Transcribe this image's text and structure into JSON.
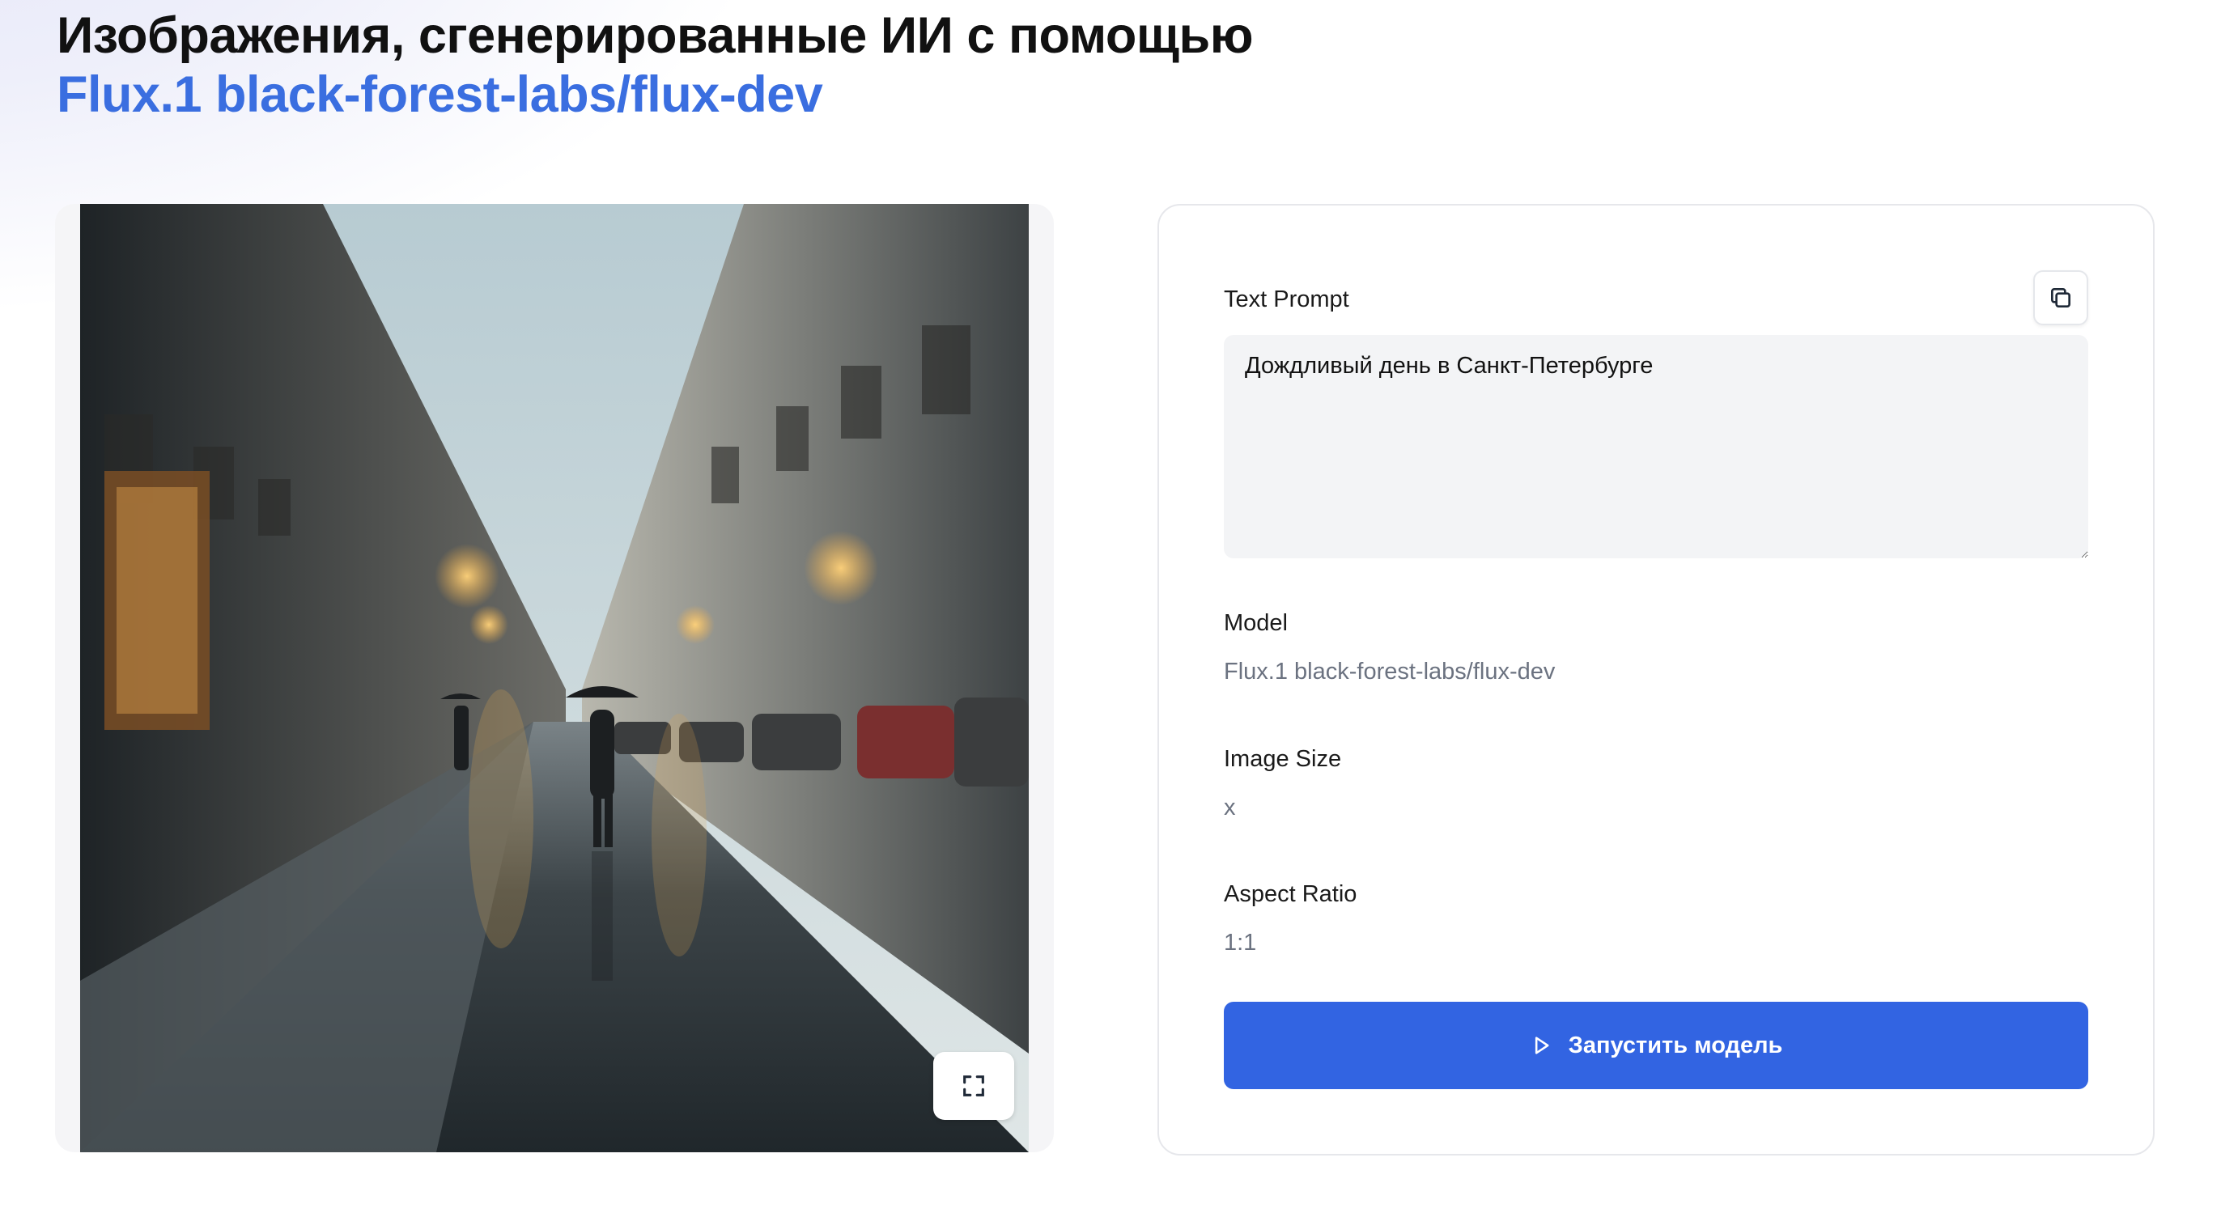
{
  "page": {
    "title_main": "Изображения, сгенерированные ИИ с помощью ",
    "title_model": "Flux.1 black-forest-labs/flux-dev"
  },
  "image_panel": {
    "image_icon": "generated-image",
    "fullscreen_icon": "fullscreen-icon"
  },
  "settings": {
    "prompt_label": "Text Prompt",
    "prompt_value": "Дождливый день в Санкт-Петербурге",
    "copy_icon": "copy-icon",
    "model_label": "Model",
    "model_value": "Flux.1 black-forest-labs/flux-dev",
    "size_label": "Image Size",
    "size_value": "x",
    "aspect_label": "Aspect Ratio",
    "aspect_value": "1:1",
    "run_label": "Запустить модель",
    "run_icon": "play-icon"
  },
  "colors": {
    "accent": "#3a6ee0",
    "button": "#3264e2",
    "muted_text": "#6b7280",
    "input_bg": "#f3f4f6"
  }
}
